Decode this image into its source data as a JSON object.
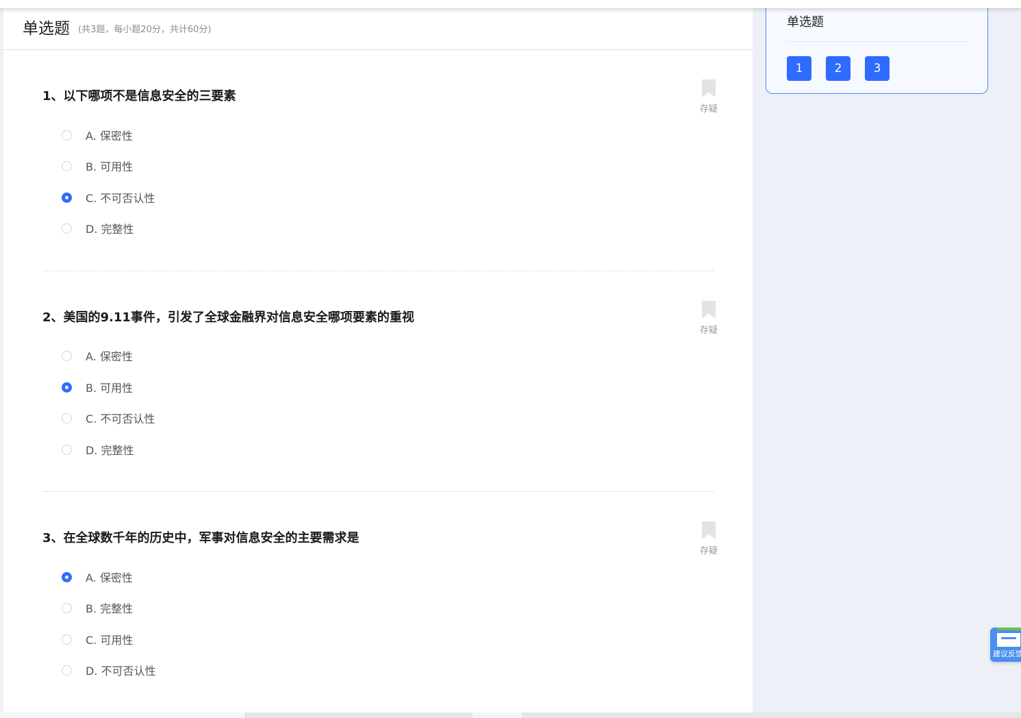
{
  "section": {
    "title": "单选题",
    "meta": "(共3题，每小题20分，共计60分)"
  },
  "questions": [
    {
      "title": "1、以下哪项不是信息安全的三要素",
      "bookmark_label": "存疑",
      "options": [
        {
          "text": "A. 保密性",
          "selected": false
        },
        {
          "text": "B. 可用性",
          "selected": false
        },
        {
          "text": "C. 不可否认性",
          "selected": true
        },
        {
          "text": "D. 完整性",
          "selected": false
        }
      ]
    },
    {
      "title": "2、美国的9.11事件，引发了全球金融界对信息安全哪项要素的重视",
      "bookmark_label": "存疑",
      "options": [
        {
          "text": "A. 保密性",
          "selected": false
        },
        {
          "text": "B. 可用性",
          "selected": true
        },
        {
          "text": "C. 不可否认性",
          "selected": false
        },
        {
          "text": "D. 完整性",
          "selected": false
        }
      ]
    },
    {
      "title": "3、在全球数千年的历史中，军事对信息安全的主要需求是",
      "bookmark_label": "存疑",
      "options": [
        {
          "text": "A. 保密性",
          "selected": true
        },
        {
          "text": "B. 完整性",
          "selected": false
        },
        {
          "text": "C. 可用性",
          "selected": false
        },
        {
          "text": "D. 不可否认性",
          "selected": false
        }
      ]
    }
  ],
  "nav": {
    "title": "单选题",
    "buttons": [
      "1",
      "2",
      "3"
    ]
  },
  "feedback": {
    "label": "建议反馈"
  },
  "colors": {
    "accent": "#2f6bff",
    "nav_border": "#4f86ff",
    "page_bg": "#eef0f7"
  }
}
